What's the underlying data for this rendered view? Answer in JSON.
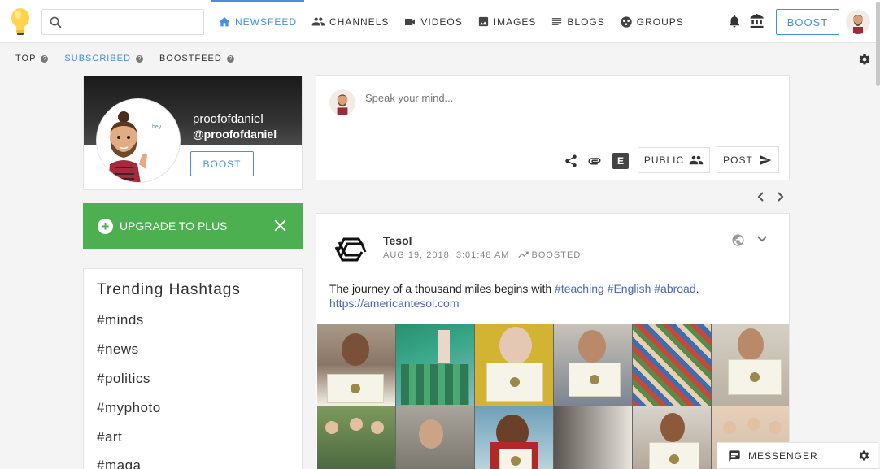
{
  "search": {
    "placeholder": ""
  },
  "nav": [
    {
      "label": "NEWSFEED",
      "icon": "home-icon",
      "active": true
    },
    {
      "label": "CHANNELS",
      "icon": "people-icon"
    },
    {
      "label": "VIDEOS",
      "icon": "video-icon"
    },
    {
      "label": "IMAGES",
      "icon": "image-icon"
    },
    {
      "label": "BLOGS",
      "icon": "blog-icon"
    },
    {
      "label": "GROUPS",
      "icon": "groups-icon"
    }
  ],
  "header": {
    "boost_label": "BOOST"
  },
  "subnav": [
    {
      "label": "TOP",
      "help": "?"
    },
    {
      "label": "SUBSCRIBED",
      "help": "?",
      "active": true
    },
    {
      "label": "BOOSTFEED",
      "help": "?"
    }
  ],
  "profile": {
    "name": "proofofdaniel",
    "handle": "@proofofdaniel",
    "avatar_caption": "hey.",
    "boost_label": "BOOST"
  },
  "upgrade": {
    "label": "UPGRADE TO PLUS"
  },
  "trending": {
    "title": "Trending Hashtags",
    "tags": [
      "#minds",
      "#news",
      "#politics",
      "#myphoto",
      "#art",
      "#maga"
    ]
  },
  "composer": {
    "placeholder": "Speak your mind...",
    "public_label": "PUBLIC",
    "post_label": "POST",
    "editor_badge": "E"
  },
  "post": {
    "author": "Tesol",
    "timestamp": "AUG 19, 2018, 3:01:48 AM",
    "boosted_label": "BOOSTED",
    "text_before": "The journey of a thousand miles begins with ",
    "hashtags": [
      "#teaching",
      "#English",
      "#abroad"
    ],
    "text_after": ".",
    "link": "https://americantesol.com"
  },
  "messenger": {
    "label": "MESSENGER"
  },
  "colors": {
    "accent": "#4690df",
    "upgrade_green": "#4caf50",
    "hashtag_blue": "#4a6bb8"
  }
}
